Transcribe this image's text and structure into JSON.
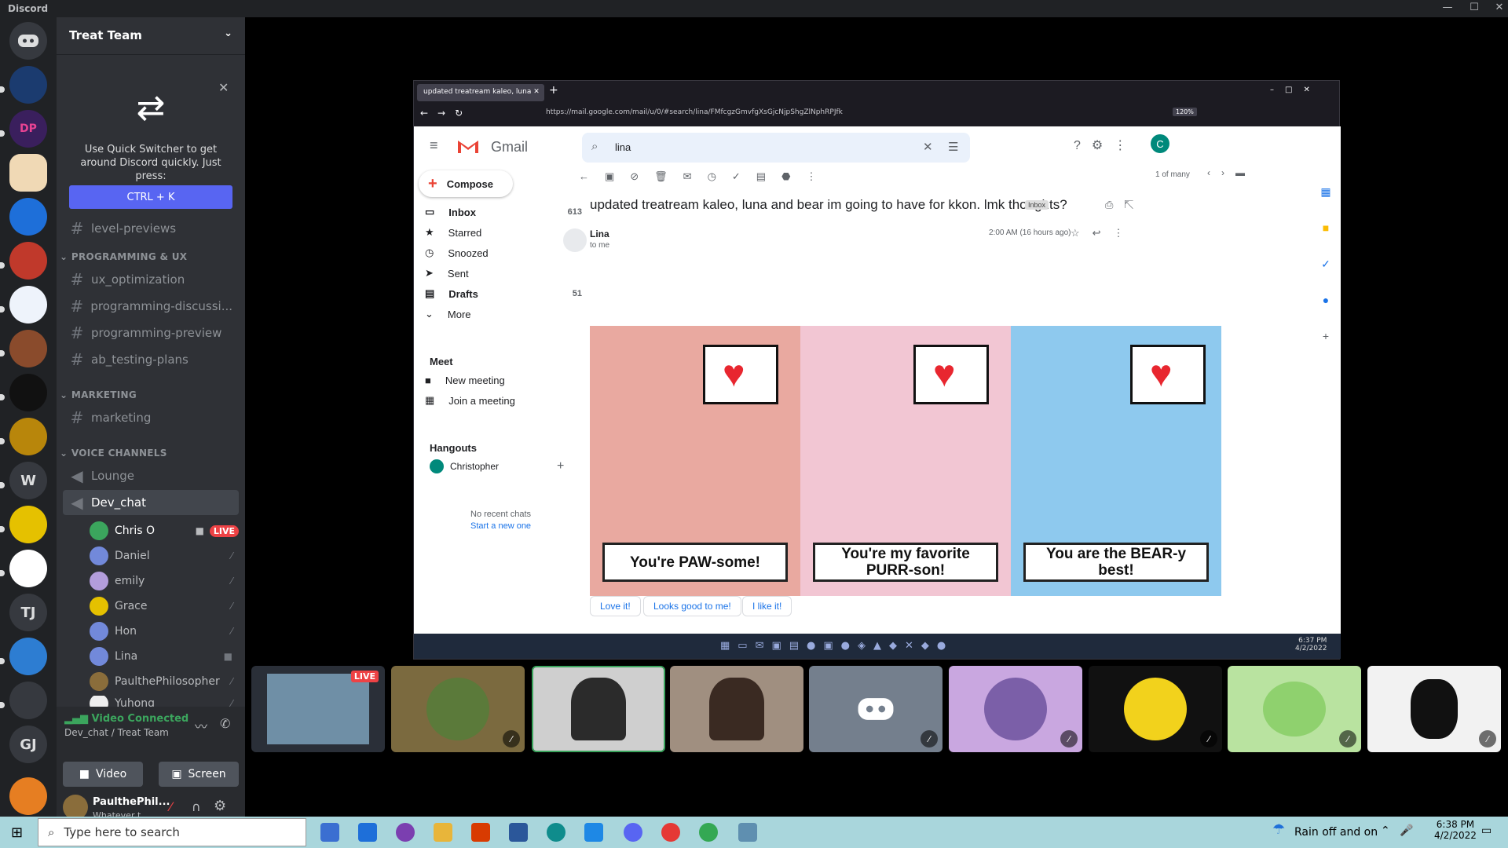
{
  "window": {
    "title": "Discord"
  },
  "rail": {
    "servers": [
      "W",
      "TJ",
      "GJ"
    ]
  },
  "sidebar": {
    "guild_name": "Treat Team",
    "switcher": {
      "text": "Use Quick Switcher to get around Discord quickly. Just press:",
      "shortcut": "CTRL + K"
    },
    "channels_top": [
      {
        "name": "level-previews"
      }
    ],
    "categories": [
      {
        "label": "PROGRAMMING & UX",
        "channels": [
          "ux_optimization",
          "programming-discussi...",
          "programming-preview",
          "ab_testing-plans"
        ]
      },
      {
        "label": "MARKETING",
        "channels": [
          "marketing"
        ]
      },
      {
        "label": "VOICE CHANNELS",
        "channels": [
          "Lounge",
          "Dev_chat"
        ]
      }
    ],
    "voice_users": [
      {
        "name": "Chris O",
        "badge": "LIVE"
      },
      {
        "name": "Daniel"
      },
      {
        "name": "emily"
      },
      {
        "name": "Grace"
      },
      {
        "name": "Hon"
      },
      {
        "name": "Lina"
      },
      {
        "name": "PaulthePhilosopher"
      },
      {
        "name": "Yuhong"
      }
    ],
    "voice_status": {
      "title": "Video Connected",
      "subtitle": "Dev_chat / Treat Team"
    },
    "buttons": {
      "video": "Video",
      "screen": "Screen"
    },
    "user": {
      "name": "PaulthePhil...",
      "status": "Whatever t..."
    }
  },
  "browser": {
    "tab_title": "updated treatream kaleo, luna",
    "url": "https://mail.google.com/mail/u/0/#search/lina/FMfcgzGmvfgXsGjcNjpShgZlNphRPJfk",
    "zoom": "120%",
    "gmail": {
      "brand": "Gmail",
      "search_value": "lina",
      "compose": "Compose",
      "nav": [
        {
          "label": "Inbox",
          "count": "613"
        },
        {
          "label": "Starred",
          "count": ""
        },
        {
          "label": "Snoozed",
          "count": ""
        },
        {
          "label": "Sent",
          "count": ""
        },
        {
          "label": "Drafts",
          "count": "51"
        },
        {
          "label": "More",
          "count": ""
        }
      ],
      "meet": {
        "title": "Meet",
        "new_meeting": "New meeting",
        "join": "Join a meeting"
      },
      "hangouts": {
        "title": "Hangouts",
        "user": "Christopher",
        "no_chats": "No recent chats",
        "start_new": "Start a new one"
      },
      "pager": "1 of many",
      "subject": "updated treatream kaleo, luna and bear im going to have for kkon. lmk thoughts?",
      "label_chip": "Inbox",
      "sender": "Lina",
      "to": "to me",
      "time": "2:00 AM (16 hours ago)",
      "cards": [
        {
          "caption": "You're PAW-some!",
          "bg": "#e9a9a0"
        },
        {
          "caption": "You're my favorite PURR-son!",
          "bg": "#f2c6d3"
        },
        {
          "caption": "You are the BEAR-y best!",
          "bg": "#8ec9ee"
        }
      ],
      "smart_replies": [
        "Love it!",
        "Looks good to me!",
        "I like it!"
      ],
      "avatar_letter": "C"
    },
    "inner_taskbar": {
      "time": "6:37 PM",
      "date": "4/2/2022"
    }
  },
  "tiles": [
    {
      "name": "screen-share",
      "badge": "LIVE"
    },
    {
      "name": "avatar-game"
    },
    {
      "name": "camera-chris"
    },
    {
      "name": "camera-woman"
    },
    {
      "name": "discord-default"
    },
    {
      "name": "anime-avatar"
    },
    {
      "name": "yellow-avatar"
    },
    {
      "name": "green-avatar"
    },
    {
      "name": "penguin-avatar"
    }
  ],
  "taskbar": {
    "search_placeholder": "Type here to search",
    "weather": "Rain off and on",
    "time": "6:38 PM",
    "date": "4/2/2022"
  }
}
